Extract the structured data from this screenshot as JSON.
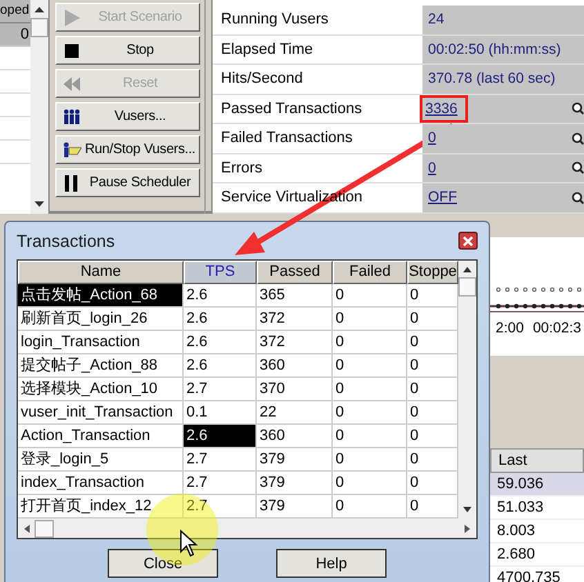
{
  "left_table": {
    "header": "oped",
    "cell": "0"
  },
  "buttons": [
    {
      "label": "Start Scenario",
      "kind": "play",
      "disabled": true
    },
    {
      "label": "Stop",
      "kind": "stop",
      "disabled": false
    },
    {
      "label": "Reset",
      "kind": "rewind",
      "disabled": true
    },
    {
      "label": "Vusers...",
      "kind": "people",
      "disabled": false
    },
    {
      "label": "Run/Stop Vusers...",
      "kind": "runstop",
      "disabled": false
    },
    {
      "label": "Pause Scheduler",
      "kind": "pause",
      "disabled": false
    }
  ],
  "status": [
    {
      "label": "Running Vusers",
      "value": "24",
      "link": false,
      "highlighted": false,
      "details": false
    },
    {
      "label": "Elapsed Time",
      "value": "00:02:50 (hh:mm:ss)",
      "link": false,
      "highlighted": false,
      "details": false
    },
    {
      "label": "Hits/Second",
      "value": "370.78 (last 60 sec)",
      "link": false,
      "highlighted": false,
      "details": false
    },
    {
      "label": "Passed Transactions",
      "value": "3336",
      "link": true,
      "highlighted": true,
      "details": true
    },
    {
      "label": "Failed Transactions",
      "value": "0",
      "link": true,
      "highlighted": false,
      "details": true
    },
    {
      "label": "Errors",
      "value": "0",
      "link": true,
      "highlighted": false,
      "details": true
    },
    {
      "label": "Service Virtualization",
      "value": "OFF",
      "link": true,
      "highlighted": false,
      "details": true
    }
  ],
  "graph": {
    "x_labels": [
      "2:00",
      "00:02:3"
    ]
  },
  "measurements": {
    "column": "Last",
    "values": [
      "59.036",
      "51.033",
      "8.003",
      "2.680",
      "4700.735"
    ]
  },
  "dialog": {
    "title": "Transactions",
    "columns": [
      {
        "label": "Name",
        "sorted": false
      },
      {
        "label": "TPS",
        "sorted": true
      },
      {
        "label": "Passed",
        "sorted": false
      },
      {
        "label": "Failed",
        "sorted": false
      },
      {
        "label": "Stoppe",
        "sorted": false
      }
    ],
    "rows": [
      {
        "cells": [
          "点击发帖_Action_68",
          "2.6",
          "365",
          "0",
          "0"
        ],
        "name_selected": true,
        "tps_selected": false
      },
      {
        "cells": [
          "刷新首页_login_26",
          "2.6",
          "372",
          "0",
          "0"
        ],
        "name_selected": false,
        "tps_selected": false
      },
      {
        "cells": [
          "login_Transaction",
          "2.6",
          "372",
          "0",
          "0"
        ],
        "name_selected": false,
        "tps_selected": false
      },
      {
        "cells": [
          "提交帖子_Action_88",
          "2.6",
          "360",
          "0",
          "0"
        ],
        "name_selected": false,
        "tps_selected": false
      },
      {
        "cells": [
          "选择模块_Action_10",
          "2.7",
          "370",
          "0",
          "0"
        ],
        "name_selected": false,
        "tps_selected": false
      },
      {
        "cells": [
          "vuser_init_Transaction",
          "0.1",
          "22",
          "0",
          "0"
        ],
        "name_selected": false,
        "tps_selected": false
      },
      {
        "cells": [
          "Action_Transaction",
          "2.6",
          "360",
          "0",
          "0"
        ],
        "name_selected": false,
        "tps_selected": true
      },
      {
        "cells": [
          "登录_login_5",
          "2.7",
          "379",
          "0",
          "0"
        ],
        "name_selected": false,
        "tps_selected": false
      },
      {
        "cells": [
          "index_Transaction",
          "2.7",
          "379",
          "0",
          "0"
        ],
        "name_selected": false,
        "tps_selected": false
      },
      {
        "cells": [
          "打开首页_index_12",
          "2.7",
          "379",
          "0",
          "0"
        ],
        "name_selected": false,
        "tps_selected": false
      }
    ],
    "buttons": [
      "Close",
      "Help"
    ]
  }
}
